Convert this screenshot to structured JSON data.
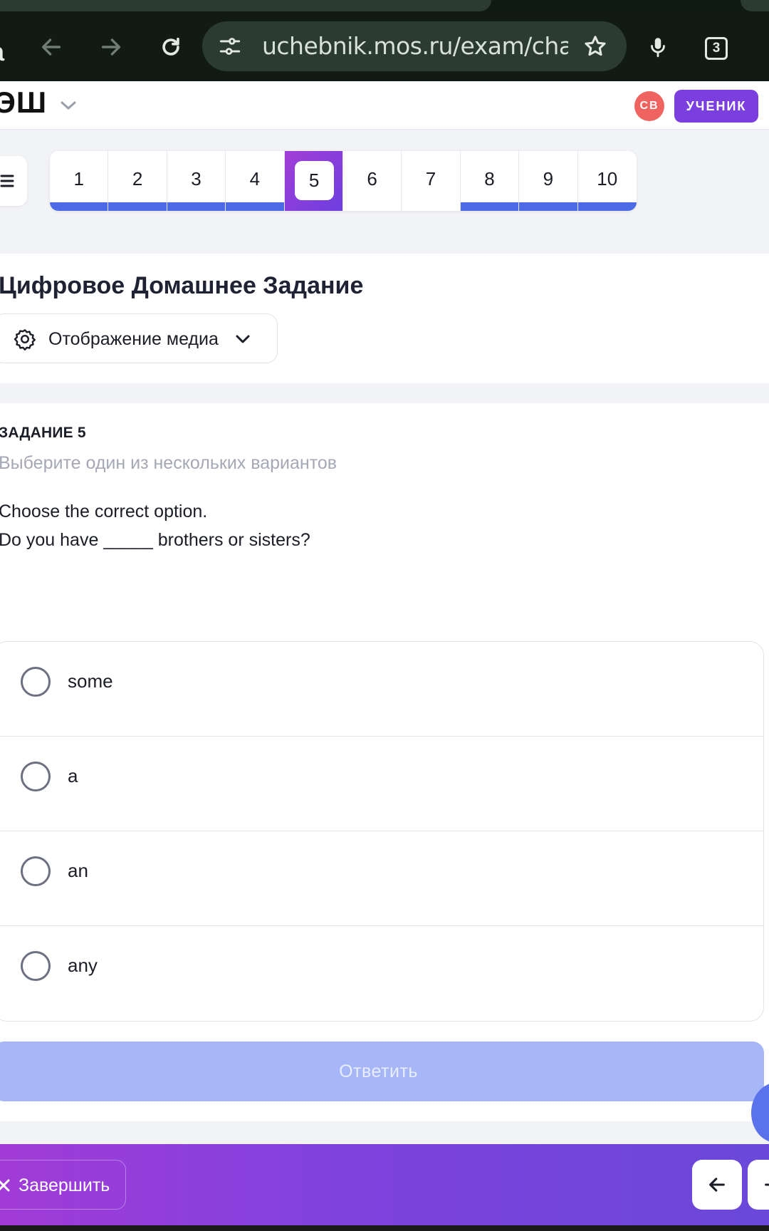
{
  "browser": {
    "url": "uchebnik.mos.ru/exam/challe",
    "tab_count": "3",
    "left_letter": "a"
  },
  "header": {
    "logo": "ЭШ",
    "avatar_initials": "СВ",
    "role_badge": "УЧЕНИК"
  },
  "question_nav": {
    "items": [
      {
        "number": "1",
        "state": "answered"
      },
      {
        "number": "2",
        "state": "answered"
      },
      {
        "number": "3",
        "state": "answered"
      },
      {
        "number": "4",
        "state": "answered"
      },
      {
        "number": "5",
        "state": "current"
      },
      {
        "number": "6",
        "state": "unanswered"
      },
      {
        "number": "7",
        "state": "unanswered"
      },
      {
        "number": "8",
        "state": "answered"
      },
      {
        "number": "9",
        "state": "answered"
      },
      {
        "number": "10",
        "state": "answered"
      }
    ]
  },
  "title_card": {
    "title": "Цифровое Домашнее Задание",
    "media_button_label": "Отображение медиа"
  },
  "task": {
    "label": "ЗАДАНИЕ 5",
    "hint": "Выберите один из нескольких вариантов",
    "instruction": "Choose the correct option.",
    "question": "Do you have _____ brothers or sisters?",
    "options": [
      {
        "label": "some",
        "selected": false
      },
      {
        "label": "a",
        "selected": false
      },
      {
        "label": "an",
        "selected": false
      },
      {
        "label": "any",
        "selected": false
      }
    ],
    "submit_label": "Ответить"
  },
  "footer": {
    "finish_label": "Завершить"
  },
  "colors": {
    "accent_blue": "#4d6ae6",
    "accent_purple": "#7b3fe0",
    "submit_disabled": "#a6b6f7",
    "avatar_red": "#ef6461"
  }
}
